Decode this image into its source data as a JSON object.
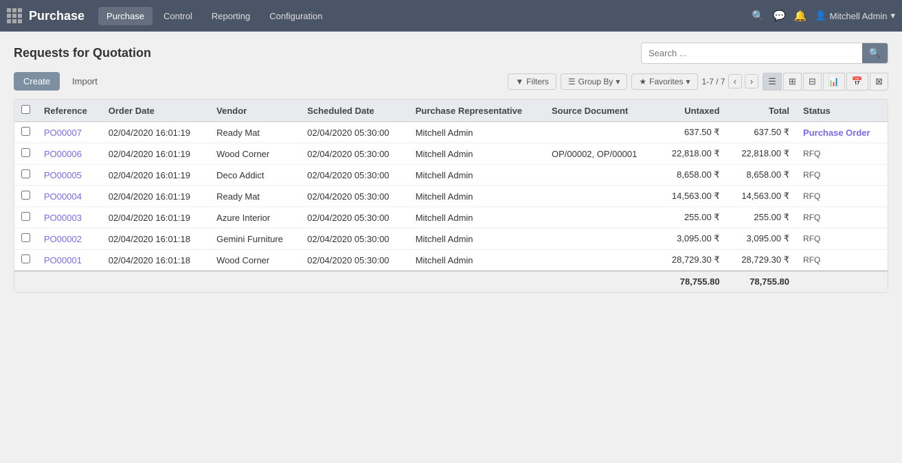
{
  "app": {
    "title": "Purchase",
    "grid_label": "Apps Menu"
  },
  "navbar": {
    "menu_items": [
      {
        "label": "Purchase",
        "active": true
      },
      {
        "label": "Control",
        "active": false
      },
      {
        "label": "Reporting",
        "active": false
      },
      {
        "label": "Configuration",
        "active": false
      }
    ],
    "search_placeholder": "Search ...",
    "user": "Mitchell Admin",
    "notification_icon": "🔔",
    "message_icon": "💬",
    "settings_icon": "⚙"
  },
  "page": {
    "title": "Requests for Quotation",
    "search_placeholder": "Search ..."
  },
  "toolbar": {
    "create_label": "Create",
    "import_label": "Import",
    "filters_label": "Filters",
    "group_by_label": "Group By",
    "favorites_label": "Favorites",
    "pager": "1-7 / 7"
  },
  "table": {
    "columns": [
      {
        "key": "reference",
        "label": "Reference"
      },
      {
        "key": "order_date",
        "label": "Order Date"
      },
      {
        "key": "vendor",
        "label": "Vendor"
      },
      {
        "key": "scheduled_date",
        "label": "Scheduled Date"
      },
      {
        "key": "purchase_rep",
        "label": "Purchase Representative"
      },
      {
        "key": "source_doc",
        "label": "Source Document"
      },
      {
        "key": "untaxed",
        "label": "Untaxed"
      },
      {
        "key": "total",
        "label": "Total"
      },
      {
        "key": "status",
        "label": "Status"
      }
    ],
    "rows": [
      {
        "reference": "PO00007",
        "order_date": "02/04/2020 16:01:19",
        "vendor": "Ready Mat",
        "scheduled_date": "02/04/2020 05:30:00",
        "purchase_rep": "Mitchell Admin",
        "source_doc": "",
        "untaxed": "637.50 ₹",
        "total": "637.50 ₹",
        "status": "Purchase Order",
        "status_class": "status-po"
      },
      {
        "reference": "PO00006",
        "order_date": "02/04/2020 16:01:19",
        "vendor": "Wood Corner",
        "scheduled_date": "02/04/2020 05:30:00",
        "purchase_rep": "Mitchell Admin",
        "source_doc": "OP/00002, OP/00001",
        "untaxed": "22,818.00 ₹",
        "total": "22,818.00 ₹",
        "status": "RFQ",
        "status_class": "status-badge"
      },
      {
        "reference": "PO00005",
        "order_date": "02/04/2020 16:01:19",
        "vendor": "Deco Addict",
        "scheduled_date": "02/04/2020 05:30:00",
        "purchase_rep": "Mitchell Admin",
        "source_doc": "",
        "untaxed": "8,658.00 ₹",
        "total": "8,658.00 ₹",
        "status": "RFQ",
        "status_class": "status-badge"
      },
      {
        "reference": "PO00004",
        "order_date": "02/04/2020 16:01:19",
        "vendor": "Ready Mat",
        "scheduled_date": "02/04/2020 05:30:00",
        "purchase_rep": "Mitchell Admin",
        "source_doc": "",
        "untaxed": "14,563.00 ₹",
        "total": "14,563.00 ₹",
        "status": "RFQ",
        "status_class": "status-badge"
      },
      {
        "reference": "PO00003",
        "order_date": "02/04/2020 16:01:19",
        "vendor": "Azure Interior",
        "scheduled_date": "02/04/2020 05:30:00",
        "purchase_rep": "Mitchell Admin",
        "source_doc": "",
        "untaxed": "255.00 ₹",
        "total": "255.00 ₹",
        "status": "RFQ",
        "status_class": "status-badge"
      },
      {
        "reference": "PO00002",
        "order_date": "02/04/2020 16:01:18",
        "vendor": "Gemini Furniture",
        "scheduled_date": "02/04/2020 05:30:00",
        "purchase_rep": "Mitchell Admin",
        "source_doc": "",
        "untaxed": "3,095.00 ₹",
        "total": "3,095.00 ₹",
        "status": "RFQ",
        "status_class": "status-badge"
      },
      {
        "reference": "PO00001",
        "order_date": "02/04/2020 16:01:18",
        "vendor": "Wood Corner",
        "scheduled_date": "02/04/2020 05:30:00",
        "purchase_rep": "Mitchell Admin",
        "source_doc": "",
        "untaxed": "28,729.30 ₹",
        "total": "28,729.30 ₹",
        "status": "RFQ",
        "status_class": "status-badge"
      }
    ],
    "totals": {
      "untaxed": "78,755.80",
      "total": "78,755.80"
    }
  }
}
